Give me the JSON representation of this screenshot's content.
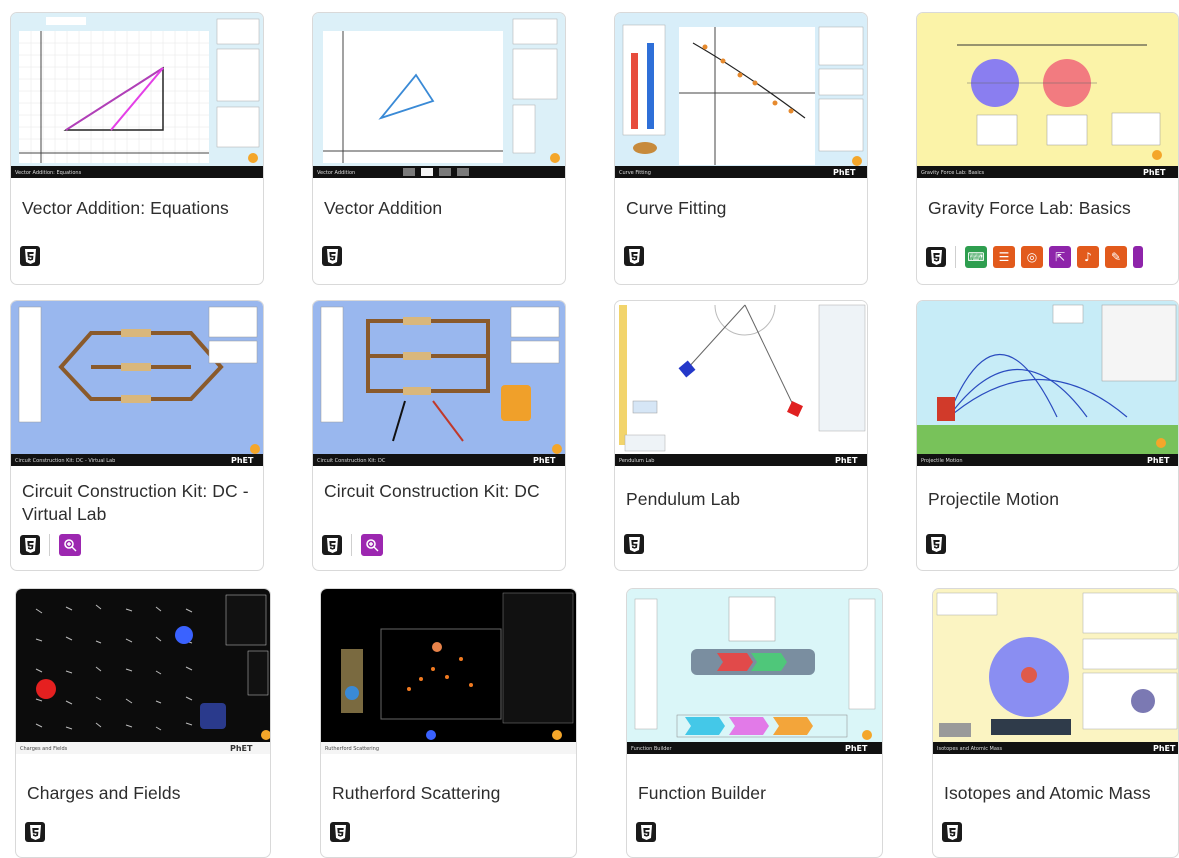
{
  "cards": [
    {
      "title": "Vector Addition: Equations",
      "features": []
    },
    {
      "title": "Vector Addition",
      "features": []
    },
    {
      "title": "Curve Fitting",
      "features": []
    },
    {
      "title": "Gravity Force Lab: Basics",
      "features": [
        {
          "name": "keyboard-icon",
          "color": "#2e9e4f"
        },
        {
          "name": "description-icon",
          "color": "#e25a1c"
        },
        {
          "name": "sonification-icon",
          "color": "#e25a1c"
        },
        {
          "name": "interactive-icon",
          "color": "#8e24aa"
        },
        {
          "name": "sound-icon",
          "color": "#e25a1c"
        },
        {
          "name": "voicing-icon",
          "color": "#e25a1c"
        },
        {
          "name": "more-icon",
          "color": "#8e24aa"
        }
      ]
    },
    {
      "title": "Circuit Construction Kit: DC - Virtual Lab",
      "features": [
        {
          "name": "zoom-icon",
          "color": "#9c27b0"
        }
      ]
    },
    {
      "title": "Circuit Construction Kit: DC",
      "features": [
        {
          "name": "zoom-icon",
          "color": "#9c27b0"
        }
      ]
    },
    {
      "title": "Pendulum Lab",
      "features": []
    },
    {
      "title": "Projectile Motion",
      "features": []
    },
    {
      "title": "Charges and Fields",
      "features": []
    },
    {
      "title": "Rutherford Scattering",
      "features": []
    },
    {
      "title": "Function Builder",
      "features": []
    },
    {
      "title": "Isotopes and Atomic Mass",
      "features": []
    }
  ],
  "thumbs": {
    "vector_addition_equations": "Vector Addition: Equations",
    "vector_addition": "Vector Addition",
    "curve_fitting": "Curve Fitting",
    "gravity": "Gravity Force Lab: Basics",
    "cck_virtual": "Circuit Construction Kit: DC - Virtual Lab",
    "cck": "Circuit Construction Kit: DC",
    "pendulum": "Pendulum Lab",
    "projectile": "Projectile Motion",
    "charges": "Charges and Fields",
    "rutherford": "Rutherford Scattering",
    "function_builder": "Function Builder",
    "isotopes": "Isotopes and Atomic Mass",
    "phet_logo": "PhET"
  },
  "colors": {
    "html5_badge": "#1a1a1a",
    "zoom_badge": "#9c27b0"
  }
}
